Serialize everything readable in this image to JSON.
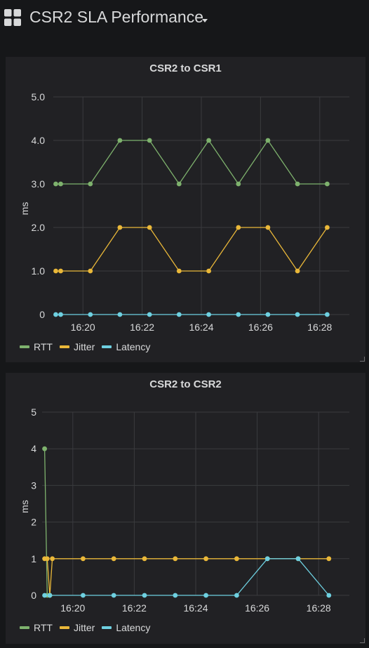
{
  "dashboard": {
    "title": "CSR2 SLA Performance"
  },
  "colors": {
    "rtt": "#7eb26d",
    "jitter": "#eab839",
    "latency": "#6ed0e0",
    "grid": "#3a3b3e",
    "text": "#d8d9da"
  },
  "icons": {
    "apps": "dashboard-grid-icon",
    "caret": "caret-down-icon",
    "resize": "panel-resize-icon"
  },
  "panels": [
    {
      "title": "CSR2 to CSR1",
      "legend": [
        {
          "label": "RTT",
          "color": "#7eb26d"
        },
        {
          "label": "Jitter",
          "color": "#eab839"
        },
        {
          "label": "Latency",
          "color": "#6ed0e0"
        }
      ]
    },
    {
      "title": "CSR2 to CSR2",
      "legend": [
        {
          "label": "RTT",
          "color": "#7eb26d"
        },
        {
          "label": "Jitter",
          "color": "#eab839"
        },
        {
          "label": "Latency",
          "color": "#6ed0e0"
        }
      ]
    }
  ],
  "chart_data": [
    {
      "type": "line",
      "title": "CSR2 to CSR1",
      "xlabel": "",
      "ylabel": "ms",
      "x_ticks": [
        "16:20",
        "16:22",
        "16:24",
        "16:26",
        "16:28"
      ],
      "y_ticks": [
        "0",
        "1.0",
        "2.0",
        "3.0",
        "4.0",
        "5.0"
      ],
      "ylim": [
        0,
        5
      ],
      "x_range": [
        "16:19",
        "16:29"
      ],
      "grid": true,
      "legend_position": "bottom-left",
      "series": [
        {
          "name": "RTT",
          "color": "#7eb26d",
          "points": [
            [
              "16:19:05",
              3
            ],
            [
              "16:19:15",
              3
            ],
            [
              "16:20:15",
              3
            ],
            [
              "16:21:15",
              4
            ],
            [
              "16:22:15",
              4
            ],
            [
              "16:23:15",
              3
            ],
            [
              "16:24:15",
              4
            ],
            [
              "16:25:15",
              3
            ],
            [
              "16:26:15",
              4
            ],
            [
              "16:27:15",
              3
            ],
            [
              "16:28:15",
              3
            ]
          ]
        },
        {
          "name": "Jitter",
          "color": "#eab839",
          "points": [
            [
              "16:19:05",
              1
            ],
            [
              "16:19:15",
              1
            ],
            [
              "16:20:15",
              1
            ],
            [
              "16:21:15",
              2
            ],
            [
              "16:22:15",
              2
            ],
            [
              "16:23:15",
              1
            ],
            [
              "16:24:15",
              1
            ],
            [
              "16:25:15",
              2
            ],
            [
              "16:26:15",
              2
            ],
            [
              "16:27:15",
              1
            ],
            [
              "16:28:15",
              2
            ]
          ]
        },
        {
          "name": "Latency",
          "color": "#6ed0e0",
          "points": [
            [
              "16:19:05",
              0
            ],
            [
              "16:19:15",
              0
            ],
            [
              "16:20:15",
              0
            ],
            [
              "16:21:15",
              0
            ],
            [
              "16:22:15",
              0
            ],
            [
              "16:23:15",
              0
            ],
            [
              "16:24:15",
              0
            ],
            [
              "16:25:15",
              0
            ],
            [
              "16:26:15",
              0
            ],
            [
              "16:27:15",
              0
            ],
            [
              "16:28:15",
              0
            ]
          ]
        }
      ]
    },
    {
      "type": "line",
      "title": "CSR2 to CSR2",
      "xlabel": "",
      "ylabel": "ms",
      "x_ticks": [
        "16:20",
        "16:22",
        "16:24",
        "16:26",
        "16:28"
      ],
      "y_ticks": [
        "0",
        "1",
        "2",
        "3",
        "4",
        "5"
      ],
      "ylim": [
        0,
        5
      ],
      "x_range": [
        "16:19",
        "16:29"
      ],
      "grid": true,
      "legend_position": "bottom-left",
      "series": [
        {
          "name": "RTT",
          "color": "#7eb26d",
          "points": [
            [
              "16:19:05",
              4
            ],
            [
              "16:19:10",
              0
            ],
            [
              "16:19:15",
              0
            ]
          ]
        },
        {
          "name": "Jitter",
          "color": "#eab839",
          "points": [
            [
              "16:19:05",
              1
            ],
            [
              "16:19:10",
              1
            ],
            [
              "16:19:15",
              0
            ],
            [
              "16:19:20",
              1
            ],
            [
              "16:20:20",
              1
            ],
            [
              "16:21:20",
              1
            ],
            [
              "16:22:20",
              1
            ],
            [
              "16:23:20",
              1
            ],
            [
              "16:24:20",
              1
            ],
            [
              "16:25:20",
              1
            ],
            [
              "16:26:20",
              1
            ],
            [
              "16:27:20",
              1
            ],
            [
              "16:28:20",
              1
            ]
          ]
        },
        {
          "name": "Latency",
          "color": "#6ed0e0",
          "points": [
            [
              "16:19:05",
              0
            ],
            [
              "16:19:15",
              0
            ],
            [
              "16:20:20",
              0
            ],
            [
              "16:21:20",
              0
            ],
            [
              "16:22:20",
              0
            ],
            [
              "16:23:20",
              0
            ],
            [
              "16:24:20",
              0
            ],
            [
              "16:25:20",
              0
            ],
            [
              "16:26:20",
              1
            ],
            [
              "16:27:20",
              1
            ],
            [
              "16:28:20",
              0
            ]
          ]
        }
      ]
    }
  ]
}
